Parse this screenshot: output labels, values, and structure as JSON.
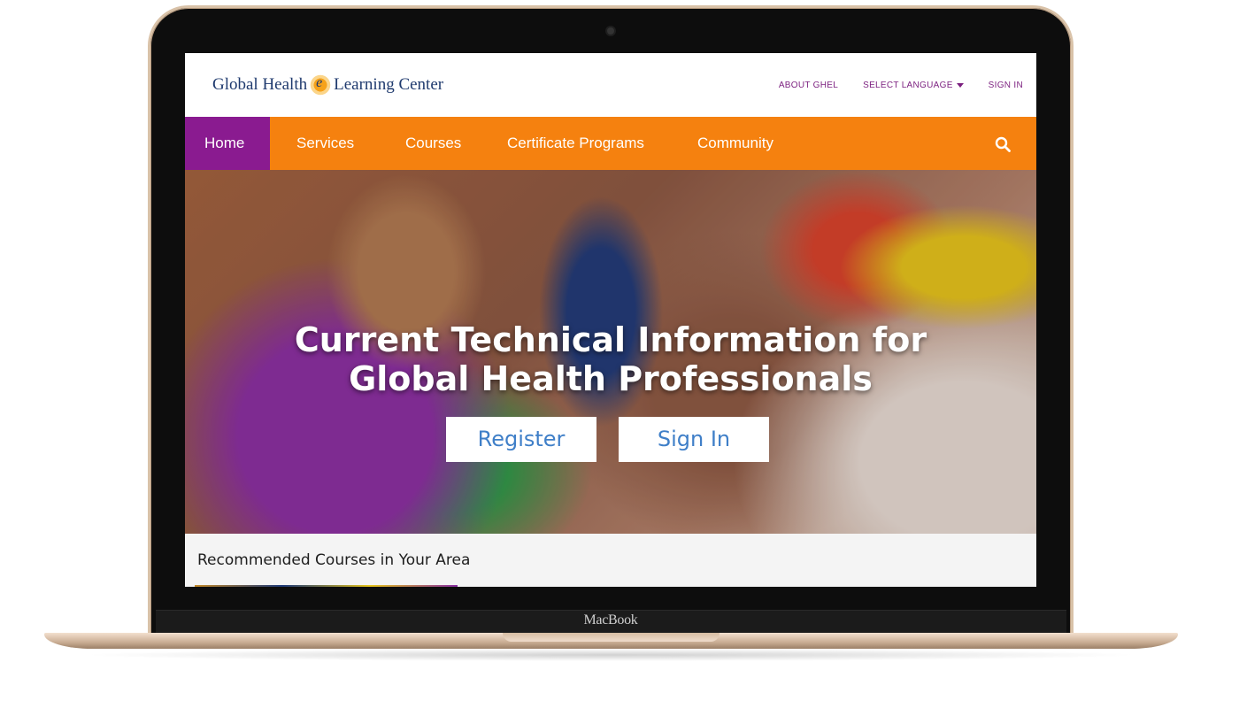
{
  "device": {
    "brand_label": "MacBook"
  },
  "site": {
    "logo": {
      "left_text": "Global Health",
      "right_text": "Learning Center"
    },
    "utility_nav": [
      {
        "label": "ABOUT GHEL"
      },
      {
        "label": "SELECT LANGUAGE",
        "has_dropdown": true
      },
      {
        "label": "SIGN IN"
      }
    ],
    "main_nav": [
      {
        "label": "Home",
        "active": true
      },
      {
        "label": "Services"
      },
      {
        "label": "Courses"
      },
      {
        "label": "Certificate Programs"
      },
      {
        "label": "Community"
      }
    ],
    "search_icon": "search-icon",
    "hero": {
      "title_line1": "Current Technical Information for",
      "title_line2": "Global Health Professionals",
      "register_label": "Register",
      "signin_label": "Sign In"
    },
    "recommended": {
      "title": "Recommended Courses in Your Area"
    }
  },
  "colors": {
    "nav_orange": "#f5810f",
    "nav_active_purple": "#8a1b90",
    "utility_link": "#7b1f7f",
    "button_text_blue": "#3f7fc8",
    "logo_navy": "#1f3a6e"
  }
}
